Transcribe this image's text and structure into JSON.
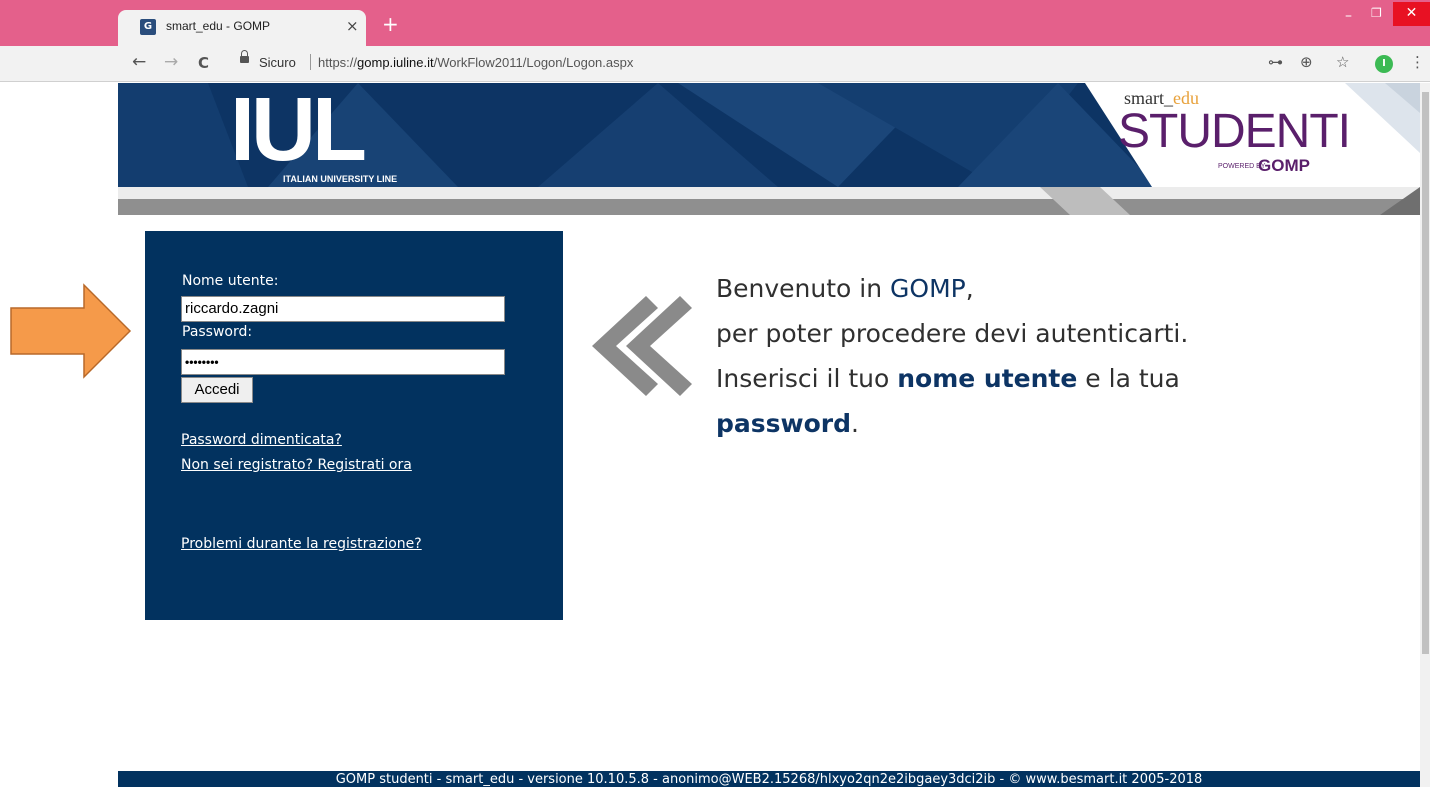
{
  "browser": {
    "tab": {
      "title": "smart_edu - GOMP",
      "favicon": "gomp-favicon",
      "close": "×"
    },
    "new_tab": "+",
    "window_controls": {
      "minimize": "–",
      "maximize": "❐",
      "close": "✕"
    },
    "nav": {
      "back": "←",
      "forward": "→",
      "reload": "C"
    },
    "security": "Sicuro",
    "url_prefix": "https://",
    "url_domain": "gomp.iuline.it",
    "url_path": "/WorkFlow2011/Logon/Logon.aspx",
    "toolbar_icons": {
      "key": "⊶",
      "zoom": "⊕",
      "star": "☆",
      "menu": "⋮"
    },
    "profile_initial": "I"
  },
  "header": {
    "logo_text": "IUL",
    "logo_subtitle": "ITALIAN UNIVERSITY LINE",
    "brand_smart": "smart_",
    "brand_edu": "edu",
    "brand_studenti": "STUDENTI",
    "powered_by": "POWERED BY",
    "gomp": "GOMP"
  },
  "login": {
    "username_label": "Nome utente:",
    "username_value": "riccardo.zagni",
    "password_label": "Password:",
    "password_value": "••••••••",
    "submit_label": "Accedi",
    "forgot_link": "Password dimenticata?",
    "register_link": "Non sei registrato? Registrati ora",
    "problems_link": "Problemi durante la registrazione?"
  },
  "welcome": {
    "line1_prefix": "Benvenuto in ",
    "line1_gomp": "GOMP",
    "line1_suffix": ",",
    "line2": "per poter procedere devi autenticarti.",
    "line3_prefix": "Inserisci il tuo ",
    "line3_bold": "nome utente",
    "line3_suffix": " e la tua",
    "line4_bold": "password",
    "line4_suffix": "."
  },
  "footer": {
    "text": "GOMP studenti - smart_edu - versione 10.10.5.8 - anonimo@WEB2.15268/hlxyo2qn2e2ibgaey3dci2ib - © www.besmart.it 2005-2018"
  },
  "colors": {
    "titlebar": "#e4608b",
    "navy": "#02325f",
    "annotation_arrow": "#f59a4a"
  }
}
